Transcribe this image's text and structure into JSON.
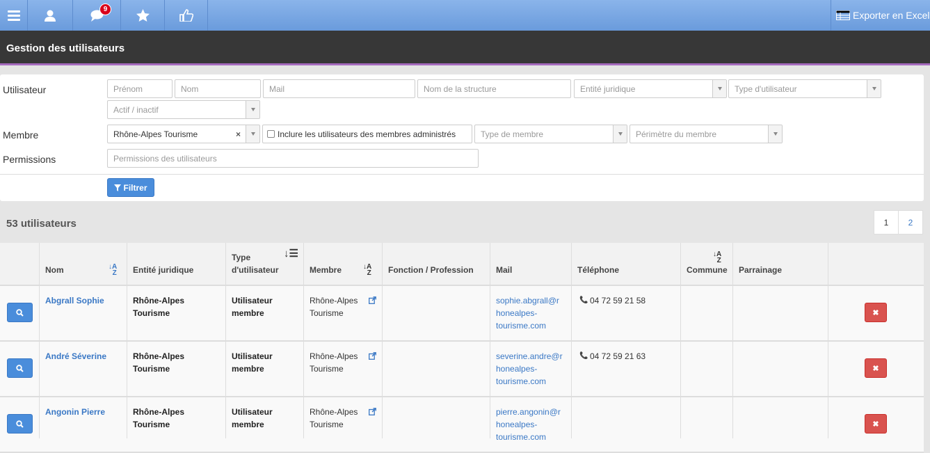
{
  "topbar": {
    "badge_count": "9",
    "export_label": "Exporter en Excel",
    "icons": [
      "menu-icon",
      "user-icon",
      "chat-icon",
      "star-icon",
      "thumbs-up-icon"
    ]
  },
  "page": {
    "title": "Gestion des utilisateurs"
  },
  "filters": {
    "label_utilisateur": "Utilisateur",
    "label_membre": "Membre",
    "label_permissions": "Permissions",
    "prenom_placeholder": "Prénom",
    "nom_placeholder": "Nom",
    "mail_placeholder": "Mail",
    "structure_placeholder": "Nom de la structure",
    "entite_placeholder": "Entité juridique",
    "type_placeholder": "Type d'utilisateur",
    "actif_placeholder": "Actif / inactif",
    "membre_value": "Rhône-Alpes Tourisme",
    "include_label": "Inclure les utilisateurs des membres administrés",
    "type_membre_placeholder": "Type de membre",
    "perimetre_placeholder": "Périmètre du membre",
    "permissions_placeholder": "Permissions des utilisateurs",
    "filter_button": "Filtrer"
  },
  "results": {
    "count_label": "53 utilisateurs",
    "pages": [
      "1",
      "2"
    ]
  },
  "table": {
    "headers": {
      "nom": "Nom",
      "entite": "Entité juridique",
      "type1": "Type",
      "type2": "d'utilisateur",
      "membre": "Membre",
      "fonction": "Fonction / Profession",
      "mail": "Mail",
      "telephone": "Téléphone",
      "commune": "Commune",
      "parrainage": "Parrainage"
    },
    "rows": [
      {
        "nom": "Abgrall Sophie",
        "entite1": "Rhône-Alpes",
        "entite2": "Tourisme",
        "type1": "Utilisateur",
        "type2": "membre",
        "membre1": "Rhône-Alpes",
        "membre2": "Tourisme",
        "mail1": "sophie.abgrall@r",
        "mail2": "honealpes-",
        "mail3": "tourisme.com",
        "tel": "04 72 59 21 58"
      },
      {
        "nom": "André Séverine",
        "entite1": "Rhône-Alpes",
        "entite2": "Tourisme",
        "type1": "Utilisateur",
        "type2": "membre",
        "membre1": "Rhône-Alpes",
        "membre2": "Tourisme",
        "mail1": "severine.andre@r",
        "mail2": "honealpes-",
        "mail3": "tourisme.com",
        "tel": "04 72 59 21 63"
      },
      {
        "nom": "Angonin Pierre",
        "entite1": "Rhône-Alpes",
        "entite2": "Tourisme",
        "type1": "Utilisateur",
        "type2": "membre",
        "membre1": "Rhône-Alpes",
        "membre2": "Tourisme",
        "mail1": "pierre.angonin@r",
        "mail2": "honealpes-",
        "mail3": "tourisme.com",
        "tel": ""
      }
    ],
    "sort_letters": {
      "top": "A",
      "bottom": "Z"
    }
  }
}
